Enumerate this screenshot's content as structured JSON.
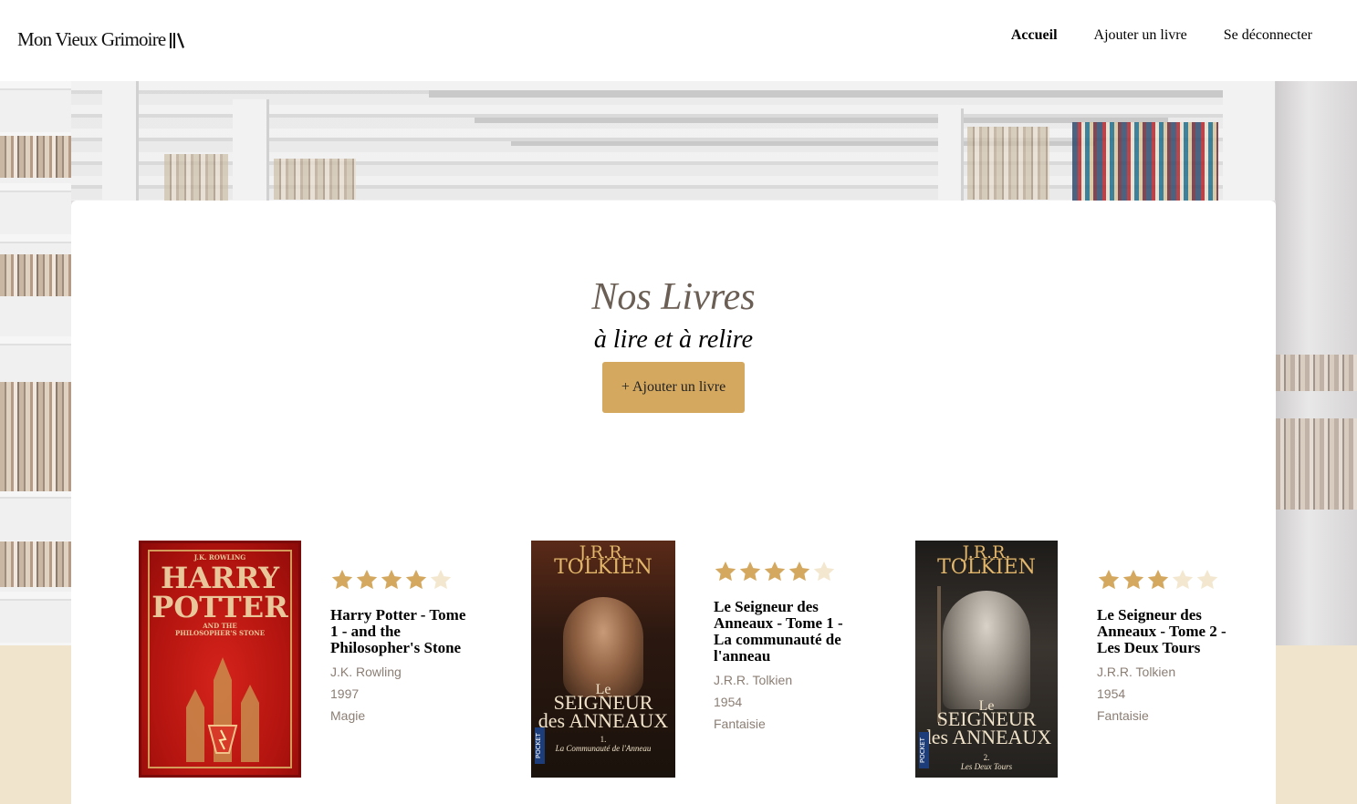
{
  "header": {
    "logo": "Mon Vieux Grimoire",
    "nav": [
      {
        "label": "Accueil",
        "active": true
      },
      {
        "label": "Ajouter un livre",
        "active": false
      },
      {
        "label": "Se déconnecter",
        "active": false
      }
    ]
  },
  "main": {
    "title": "Nos Livres",
    "subtitle": "à lire et à relire",
    "add_button": "+ Ajouter un livre"
  },
  "colors": {
    "accent": "#d4a85f",
    "star_filled": "#d4a85f",
    "star_empty": "#f3e7d0",
    "title": "#6b5f55",
    "meta": "#8b7e74",
    "beige_band": "#f1e4cd"
  },
  "books": [
    {
      "title": "Harry Potter - Tome 1 - and the Philosopher's Stone",
      "author": "J.K. Rowling",
      "year": "1997",
      "genre": "Magie",
      "rating": 4,
      "cover": {
        "line1": "J.K. ROWLING",
        "line2": "HARRY",
        "line3": "POTTER",
        "line4": "AND THE",
        "line5": "PHILOSOPHER'S STONE"
      }
    },
    {
      "title": "Le Seigneur des Anneaux - Tome 1 - La communauté de l'anneau",
      "author": "J.R.R. Tolkien",
      "year": "1954",
      "genre": "Fantaisie",
      "rating": 4,
      "cover": {
        "author_top": "J.R.R.",
        "author_bottom": "TOLKIEN",
        "series1": "Le",
        "series2": "SEIGNEUR",
        "series3": "des ANNEAUX",
        "volume": "1.",
        "subtitle": "La Communauté de l'Anneau",
        "publisher": "POCKET"
      }
    },
    {
      "title": "Le Seigneur des Anneaux - Tome 2 - Les Deux Tours",
      "author": "J.R.R. Tolkien",
      "year": "1954",
      "genre": "Fantaisie",
      "rating": 3,
      "cover": {
        "author_top": "J.R.R.",
        "author_bottom": "TOLKIEN",
        "series1": "Le",
        "series2": "SEIGNEUR",
        "series3": "des ANNEAUX",
        "volume": "2.",
        "subtitle": "Les Deux Tours",
        "publisher": "POCKET"
      }
    }
  ]
}
